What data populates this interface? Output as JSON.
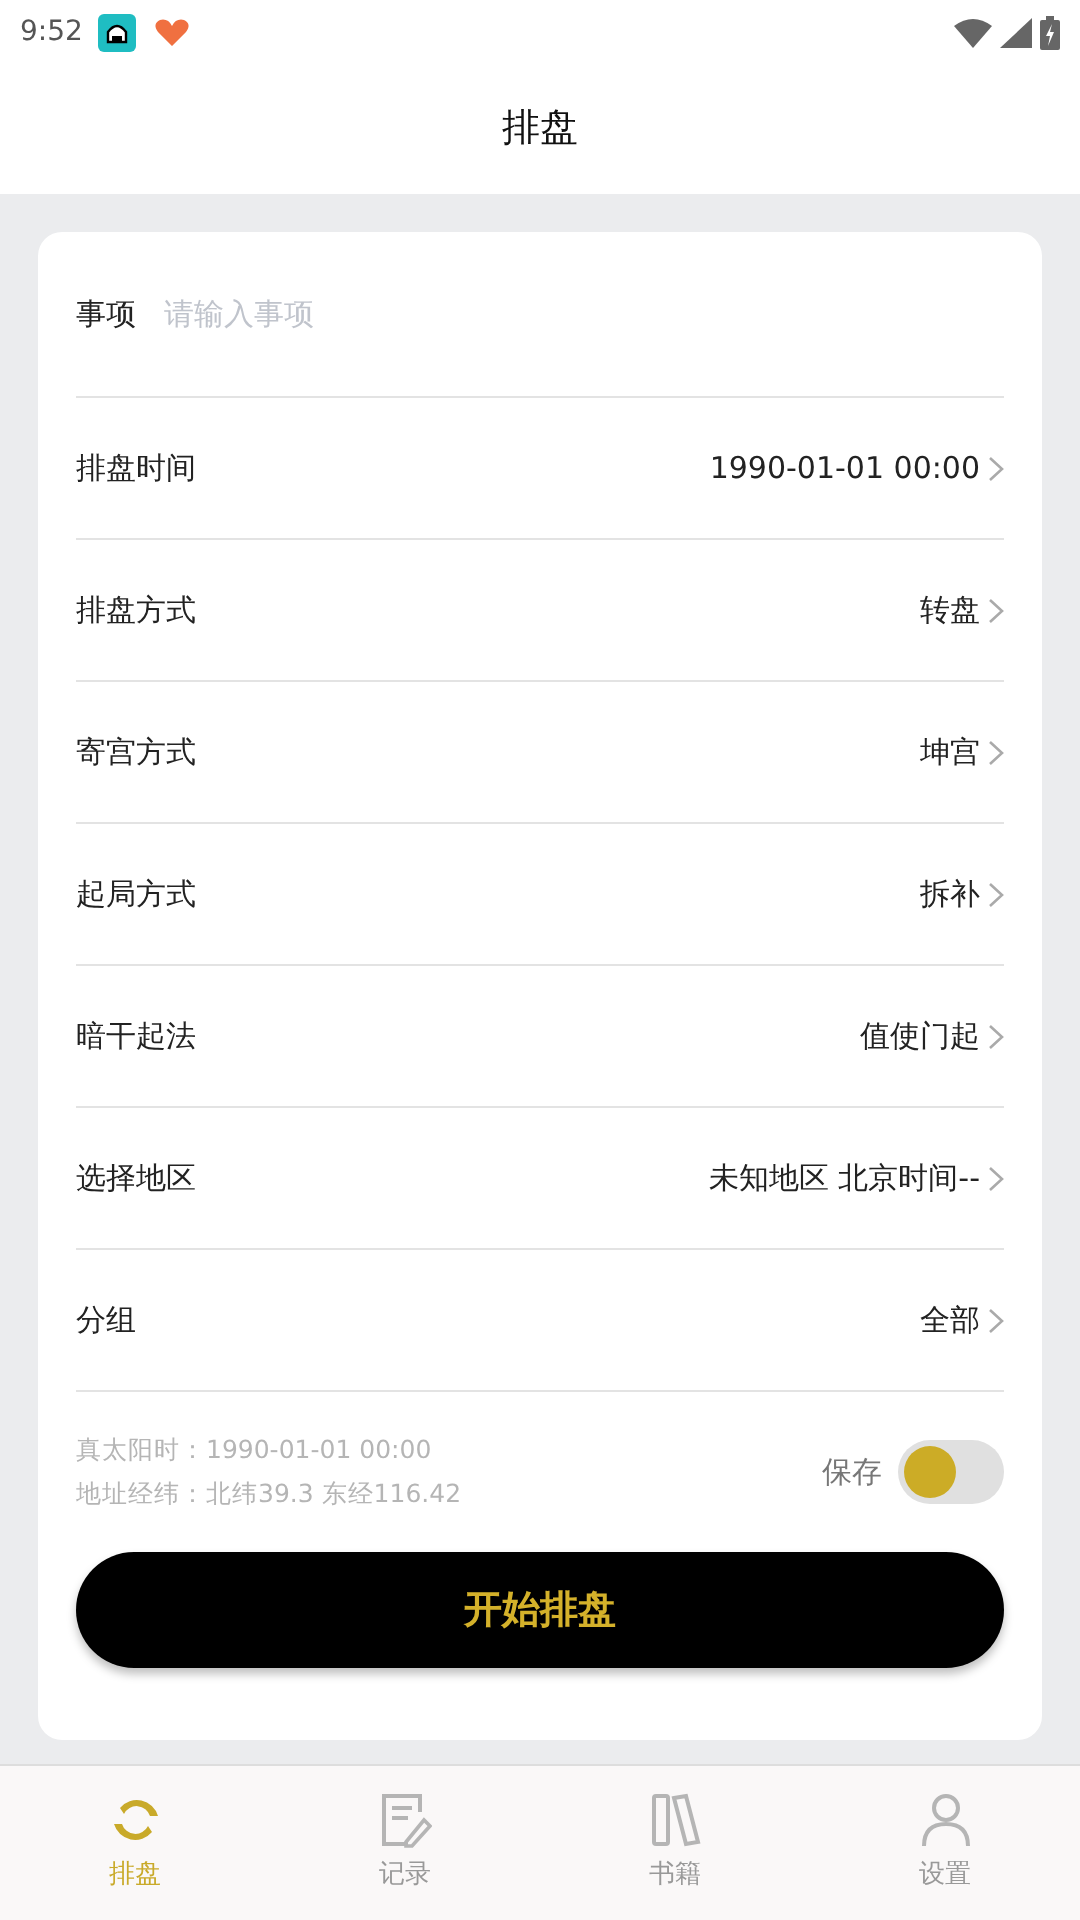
{
  "status_bar": {
    "time": "9:52"
  },
  "header": {
    "title": "排盘"
  },
  "event_field": {
    "label": "事项",
    "placeholder": "请输入事项"
  },
  "settings": [
    {
      "label": "排盘时间",
      "value": "1990-01-01 00:00"
    },
    {
      "label": "排盘方式",
      "value": "转盘"
    },
    {
      "label": "寄宫方式",
      "value": "坤宫"
    },
    {
      "label": "起局方式",
      "value": "拆补"
    },
    {
      "label": "暗干起法",
      "value": "值使门起"
    },
    {
      "label": "选择地区",
      "value": "未知地区 北京时间--"
    },
    {
      "label": "分组",
      "value": "全部"
    }
  ],
  "info": {
    "solar_time": "真太阳时：1990-01-01 00:00",
    "coordinates": "地址经纬：北纬39.3 东经116.42"
  },
  "save_toggle": {
    "label": "保存",
    "on": false
  },
  "start_button": {
    "label": "开始排盘"
  },
  "tabs": [
    {
      "kind": "circle",
      "label": "排盘",
      "selected": true
    },
    {
      "kind": "note",
      "label": "记录",
      "selected": false
    },
    {
      "kind": "books",
      "label": "书籍",
      "selected": false
    },
    {
      "kind": "person",
      "label": "设置",
      "selected": false
    }
  ]
}
